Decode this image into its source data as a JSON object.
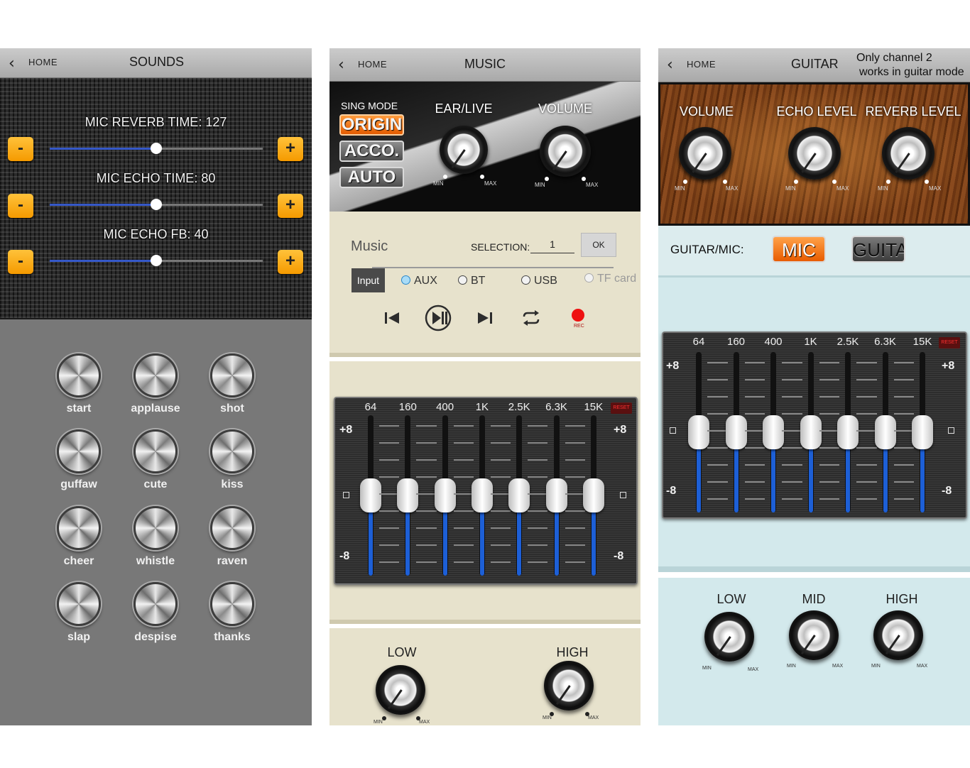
{
  "panel_sounds": {
    "header": {
      "back_icon": "‹",
      "home": "HOME",
      "title": "SOUNDS"
    },
    "sliders": [
      {
        "label": "MIC REVERB TIME:  127",
        "minus": "-",
        "plus": "+",
        "level": 0.5
      },
      {
        "label": "MIC ECHO TIME:  80",
        "minus": "-",
        "plus": "+",
        "level": 0.5
      },
      {
        "label": "MIC ECHO FB:  40",
        "minus": "-",
        "plus": "+",
        "level": 0.5
      }
    ],
    "buttons": [
      "start",
      "applause",
      "shot",
      "guffaw",
      "cute",
      "kiss",
      "cheer",
      "whistle",
      "raven",
      "slap",
      "despise",
      "thanks"
    ]
  },
  "panel_music": {
    "header": {
      "back_icon": "‹",
      "home": "HOME",
      "title": "MUSIC"
    },
    "sing_mode": {
      "label": "SING MODE",
      "options": [
        "ORIGIN",
        "ACCO.",
        "AUTO"
      ],
      "selected": "ORIGIN"
    },
    "knobs": [
      {
        "label": "EAR/LIVE",
        "min": "MIN",
        "max": "MAX"
      },
      {
        "label": "VOLUME",
        "min": "MIN",
        "max": "MAX"
      }
    ],
    "music_label": "Music",
    "selection_label": "SELECTION:",
    "selection_value": "1",
    "ok": "OK",
    "input_label": "Input",
    "inputs": [
      {
        "label": "AUX",
        "selected": true,
        "enabled": true
      },
      {
        "label": "BT",
        "selected": false,
        "enabled": true
      },
      {
        "label": "USB",
        "selected": false,
        "enabled": true
      },
      {
        "label": "TF card",
        "selected": false,
        "enabled": false
      }
    ],
    "transport_icons": [
      "skip-back-icon",
      "play-pause-icon",
      "skip-forward-icon",
      "repeat-icon",
      "record-icon"
    ],
    "rec_label": "REC",
    "eq": {
      "bands": [
        "64",
        "160",
        "400",
        "1K",
        "2.5K",
        "6.3K",
        "15K"
      ],
      "reset": "RESET",
      "top": "+8",
      "mid": "0",
      "bottom": "-8",
      "levels": [
        0,
        0,
        0,
        0,
        0,
        0,
        0
      ]
    },
    "tone_knobs": [
      {
        "label": "LOW",
        "min": "MIN",
        "max": "MAX"
      },
      {
        "label": "HIGH",
        "min": "MIN",
        "max": "MAX"
      }
    ]
  },
  "panel_guitar": {
    "header": {
      "back_icon": "‹",
      "home": "HOME",
      "title": "GUITAR",
      "note_line1": "Only channel 2",
      "note_line2": "works in guitar mode"
    },
    "knobs": [
      {
        "label": "VOLUME",
        "min": "MIN",
        "max": "MAX"
      },
      {
        "label": "ECHO LEVEL",
        "min": "MIN",
        "max": "MAX"
      },
      {
        "label": "REVERB LEVEL",
        "min": "MIN",
        "max": "MAX"
      }
    ],
    "guitar_mic_label": "GUITAR/MIC:",
    "mic": "MIC",
    "guitar": "GUITA",
    "selected": "MIC",
    "eq": {
      "bands": [
        "64",
        "160",
        "400",
        "1K",
        "2.5K",
        "6.3K",
        "15K"
      ],
      "reset": "RESET",
      "top": "+8",
      "mid": "0",
      "bottom": "-8",
      "levels": [
        0,
        0,
        0,
        0,
        0,
        0,
        0
      ]
    },
    "tone_knobs": [
      {
        "label": "LOW",
        "min": "MIN",
        "max": "MAX"
      },
      {
        "label": "MID",
        "min": "MIN",
        "max": "MAX"
      },
      {
        "label": "HIGH",
        "min": "MIN",
        "max": "MAX"
      }
    ]
  },
  "colors": {
    "accent_orange": "#f59a00",
    "eq_fill_blue": "#1d5fd6",
    "rec_red": "#e11111",
    "cream": "#e7e2cc",
    "light_blue": "#d3e9ec"
  }
}
